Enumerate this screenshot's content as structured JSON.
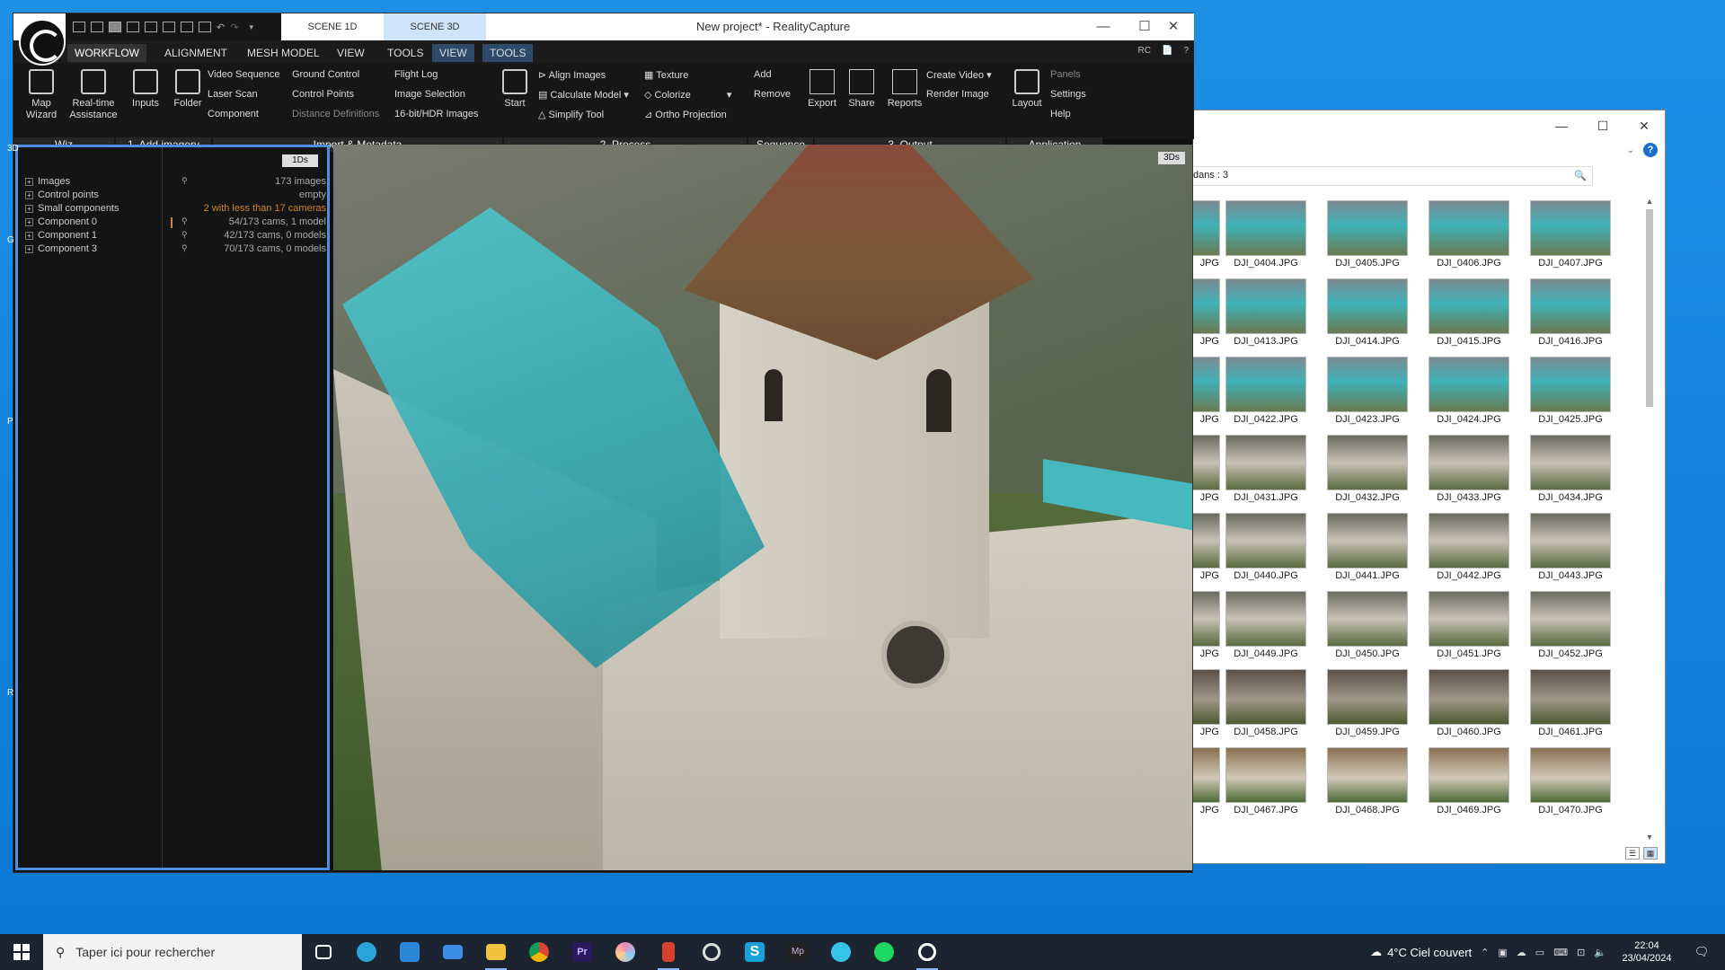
{
  "rc": {
    "title": "New project* - RealityCapture",
    "scene_tabs": [
      "SCENE 1D",
      "SCENE 3D"
    ],
    "window_controls": [
      "—",
      "☐",
      "✕"
    ],
    "menu": [
      "WORKFLOW",
      "ALIGNMENT",
      "MESH MODEL",
      "VIEW",
      "TOOLS",
      "VIEW",
      "TOOLS"
    ],
    "menu_right": [
      "RC",
      "📄",
      "?"
    ],
    "big_buttons": [
      "Map\nWizard",
      "Real-time\nAssistance",
      "Inputs",
      "Folder",
      "Start",
      "Export",
      "Share",
      "Reports",
      "Layout"
    ],
    "import_items": [
      "Video Sequence",
      "Ground Control",
      "Flight Log",
      "Laser Scan",
      "Control Points",
      "Image Selection",
      "Component",
      "Distance Definitions",
      "16-bit/HDR Images"
    ],
    "process_items": [
      "Align Images",
      "Texture",
      "Calculate Model",
      "Colorize",
      "Simplify Tool",
      "Ortho Projection"
    ],
    "sequence_items": [
      "Add",
      "Remove"
    ],
    "output_items": [
      "Create Video",
      "Render Image"
    ],
    "app_items": [
      "Panels",
      "Settings",
      "Help"
    ],
    "sections": [
      "Wiz",
      "1. Add imagery",
      "Import & Metadata",
      "2. Process",
      "Sequence",
      "3. Output",
      "Application"
    ],
    "panel_mode": "1Ds",
    "viewport_mode": "3Ds",
    "edge_labels": [
      "3D",
      "G",
      "P",
      "R"
    ],
    "tree": [
      {
        "name": "Images",
        "pin": "⚲",
        "value": "173 images"
      },
      {
        "name": "Control points",
        "pin": "",
        "value": "empty"
      },
      {
        "name": "Small components",
        "pin": "",
        "value": "2 with less than 17 cameras"
      },
      {
        "name": "Component 0",
        "pin": "⚲",
        "value": "54/173 cams, 1 model"
      },
      {
        "name": "Component 1",
        "pin": "⚲",
        "value": "42/173 cams, 0 models"
      },
      {
        "name": "Component 3",
        "pin": "⚲",
        "value": "70/173 cams, 0 models"
      }
    ]
  },
  "explorer": {
    "address": "dans : 3",
    "search_icon": "🔍",
    "window_controls": [
      "—",
      "☐",
      "✕"
    ],
    "files": [
      [
        "JPG",
        "DJI_0404.JPG",
        "DJI_0405.JPG",
        "DJI_0406.JPG",
        "DJI_0407.JPG"
      ],
      [
        "JPG",
        "DJI_0413.JPG",
        "DJI_0414.JPG",
        "DJI_0415.JPG",
        "DJI_0416.JPG"
      ],
      [
        "JPG",
        "DJI_0422.JPG",
        "DJI_0423.JPG",
        "DJI_0424.JPG",
        "DJI_0425.JPG"
      ],
      [
        "JPG",
        "DJI_0431.JPG",
        "DJI_0432.JPG",
        "DJI_0433.JPG",
        "DJI_0434.JPG"
      ],
      [
        "JPG",
        "DJI_0440.JPG",
        "DJI_0441.JPG",
        "DJI_0442.JPG",
        "DJI_0443.JPG"
      ],
      [
        "JPG",
        "DJI_0449.JPG",
        "DJI_0450.JPG",
        "DJI_0451.JPG",
        "DJI_0452.JPG"
      ],
      [
        "JPG",
        "DJI_0458.JPG",
        "DJI_0459.JPG",
        "DJI_0460.JPG",
        "DJI_0461.JPG"
      ],
      [
        "JPG",
        "DJI_0467.JPG",
        "DJI_0468.JPG",
        "DJI_0469.JPG",
        "DJI_0470.JPG"
      ]
    ]
  },
  "taskbar": {
    "search_placeholder": "Taper ici pour rechercher",
    "weather": "4°C  Ciel couvert",
    "time": "22:04",
    "date": "23/04/2024"
  }
}
